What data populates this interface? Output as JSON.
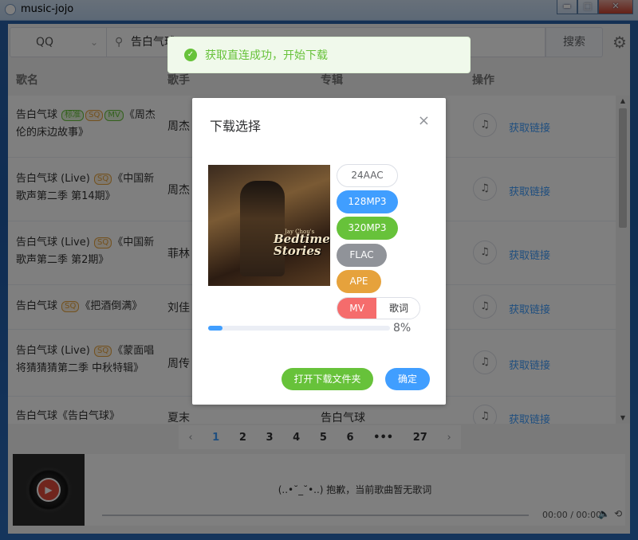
{
  "window": {
    "title": "music-jojo",
    "min": "▬",
    "max": "□",
    "close": "✕"
  },
  "search": {
    "source": "QQ",
    "query": "告白气球",
    "button": "搜索"
  },
  "table": {
    "headers": {
      "song": "歌名",
      "singer": "歌手",
      "album": "专辑",
      "op": "操作"
    },
    "rows": [
      {
        "title": "告白气球",
        "tags": [
          "标准",
          "SQ",
          "MV"
        ],
        "suffix": "《周杰伦的床边故事》",
        "singer": "周杰",
        "album": "",
        "link": "获取链接"
      },
      {
        "title": "告白气球 (Live)",
        "tags": [
          "SQ"
        ],
        "suffix": "《中国新歌声第二季 第14期》",
        "singer": "周杰",
        "album": "",
        "link": "获取链接"
      },
      {
        "title": "告白气球 (Live)",
        "tags": [
          "SQ"
        ],
        "suffix": "《中国新歌声第二季 第2期》",
        "singer": "菲林",
        "album": "",
        "link": "获取链接"
      },
      {
        "title": "告白气球",
        "tags": [
          "SQ"
        ],
        "suffix": "《把酒倒满》",
        "singer": "刘佳",
        "album": "",
        "link": "获取链接"
      },
      {
        "title": "告白气球 (Live)",
        "tags": [
          "SQ"
        ],
        "suffix": "《蒙面唱将猜猜猜第二季 中秋特辑》",
        "singer": "周传",
        "album": "",
        "link": "获取链接"
      },
      {
        "title": "告白气球",
        "tags": [],
        "suffix": "《告白气球》",
        "singer": "夏末",
        "album": "告白气球",
        "link": "获取链接"
      }
    ]
  },
  "pagination": {
    "prev": "‹",
    "pages": [
      "1",
      "2",
      "3",
      "4",
      "5",
      "6",
      "•••",
      "27"
    ],
    "next": "›",
    "current": "1"
  },
  "player": {
    "lyric_message": "(..•˘_˘•..) 抱歉，当前歌曲暂无歌词",
    "time": "00:00 / 00:00"
  },
  "toast": {
    "message": "获取直连成功，开始下载"
  },
  "dialog": {
    "title": "下载选择",
    "close": "×",
    "cover": {
      "title": "Bedtime Stories",
      "subtitle": "Jay Chou's"
    },
    "qualities": [
      "24AAC",
      "128MP3",
      "320MP3",
      "FLAC",
      "APE"
    ],
    "mv_label": "MV",
    "lyric_label": "歌词",
    "progress_percent": 8,
    "progress_text": "8%",
    "open_folder": "打开下载文件夹",
    "confirm": "确定"
  },
  "colors": {
    "primary": "#409eff",
    "success": "#67c23a",
    "warning": "#e6a23c",
    "danger": "#f56c6c",
    "info": "#909399"
  }
}
